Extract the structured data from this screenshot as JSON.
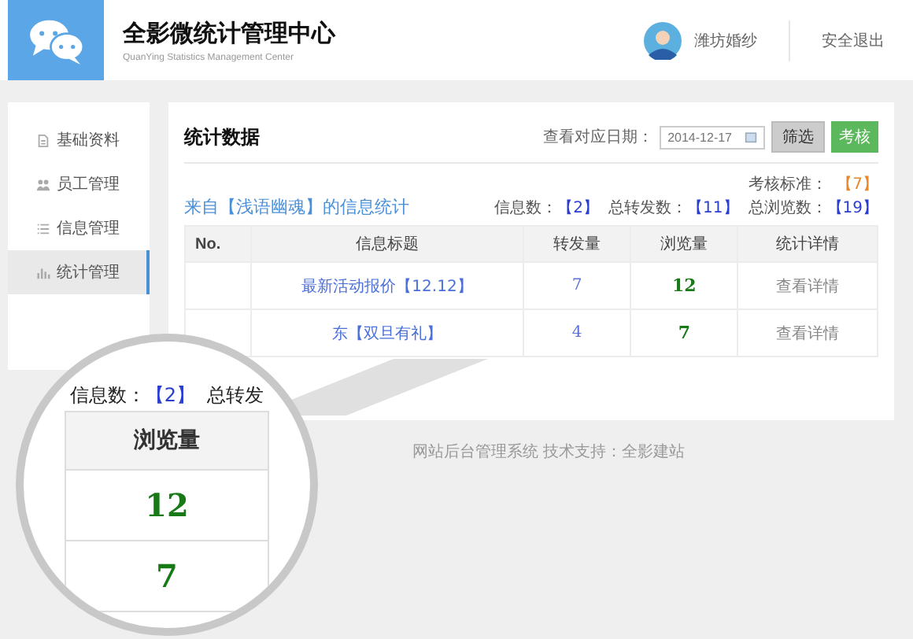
{
  "header": {
    "title": "全影微统计管理中心",
    "subtitle": "QuanYing Statistics Management Center",
    "user_name": "潍坊婚纱",
    "logout": "安全退出"
  },
  "sidebar": {
    "items": [
      {
        "label": "基础资料",
        "selected": false
      },
      {
        "label": "员工管理",
        "selected": false
      },
      {
        "label": "信息管理",
        "selected": false
      },
      {
        "label": "统计管理",
        "selected": true
      }
    ]
  },
  "main": {
    "title": "统计数据",
    "date_label": "查看对应日期：",
    "date_value": "2014-12-17",
    "filter_button": "筛选",
    "assess_button": "考核",
    "source_title": "来自【浅语幽魂】的信息统计",
    "standard": {
      "label": "考核标准：",
      "value": "【7】"
    },
    "stats": [
      {
        "label": "信息数：",
        "value": "【2】"
      },
      {
        "label": "总转发数：",
        "value": "【11】"
      },
      {
        "label": "总浏览数：",
        "value": "【19】"
      }
    ],
    "table": {
      "columns": [
        "No.",
        "信息标题",
        "转发量",
        "浏览量",
        "统计详情"
      ],
      "rows": [
        {
          "title": "最新活动报价【12.12】",
          "shares": "7",
          "views": "12",
          "detail": "查看详情"
        },
        {
          "title": "东【双旦有礼】",
          "shares": "4",
          "views": "7",
          "detail": "查看详情"
        }
      ]
    }
  },
  "footer": "网站后台管理系统  技术支持：全影建站",
  "magnifier": {
    "stat_label": "信息数：",
    "stat_value": "【2】",
    "stat_cut": "总转发",
    "header": "浏览量",
    "values": [
      "12",
      "7"
    ]
  }
}
